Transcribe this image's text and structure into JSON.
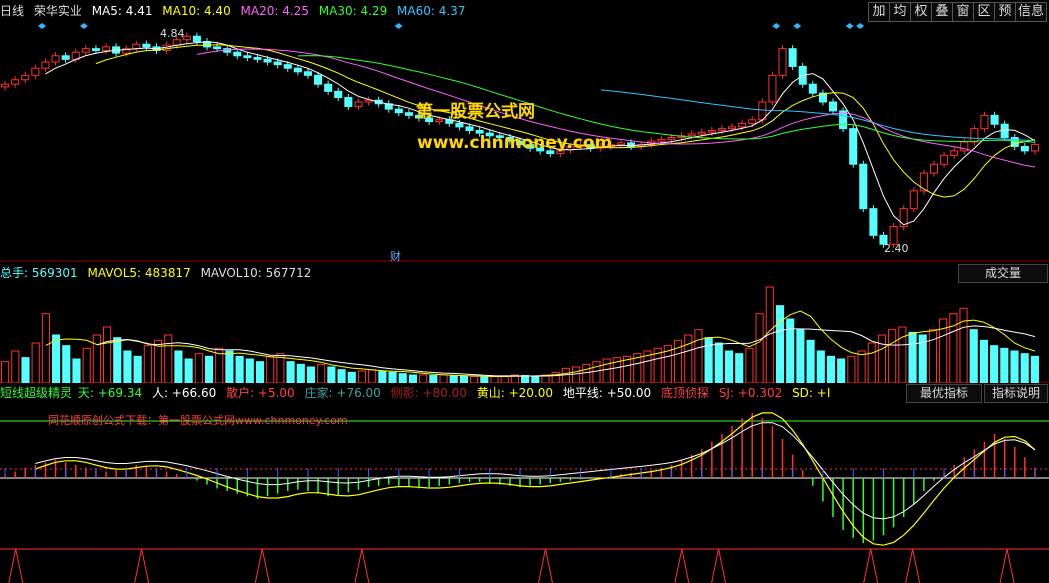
{
  "header": {
    "period": "日线",
    "stock_name": "荣华实业",
    "ma5": "MA5: 4.41",
    "ma10": "MA10: 4.40",
    "ma20": "MA20: 4.25",
    "ma30": "MA30: 4.29",
    "ma60": "MA60: 4.37"
  },
  "toolbar": [
    "加",
    "均",
    "权",
    "叠",
    "窗",
    "区",
    "预",
    "信息"
  ],
  "watermark": {
    "line1": "第一股票公式网",
    "line2": "www.chnmoney.com"
  },
  "price_labels": {
    "high": "4.84",
    "low": "2.40",
    "finance_marker": "财"
  },
  "volume_header": {
    "total": "总手: 569301",
    "mavol5": "MAVOL5: 483817",
    "mavol10": "MAVOL10: 567712",
    "selector": "成交量"
  },
  "indicator_header": {
    "name": "短线超级精灵",
    "tian": "天: +69.34",
    "ren": "人: +66.60",
    "sanhu": "散户: +5.00",
    "zhuangjia": "庄家: +76.00",
    "cejing": "侧影: +80.00",
    "huangshan": "黄山: +20.00",
    "dipingxian": "地平线: +50.00",
    "dingdi": "底顶侦探",
    "sj": "SJ: +0.302",
    "sd": "SD: +I",
    "btn_best": "最优指标",
    "btn_help": "指标说明"
  },
  "indicator_note": "同花顺原创公式下载：第一股票公式网www.chnmoney.com",
  "chart_data": {
    "type": "bar",
    "panes": [
      {
        "name": "price",
        "kind": "candlestick",
        "ylim": [
          2.3,
          5.0
        ],
        "close_series": [
          4.3,
          4.35,
          4.4,
          4.48,
          4.55,
          4.62,
          4.58,
          4.66,
          4.7,
          4.68,
          4.72,
          4.65,
          4.7,
          4.75,
          4.72,
          4.68,
          4.74,
          4.8,
          4.84,
          4.78,
          4.72,
          4.7,
          4.66,
          4.62,
          4.6,
          4.58,
          4.55,
          4.52,
          4.48,
          4.44,
          4.4,
          4.3,
          4.22,
          4.15,
          4.05,
          4.1,
          4.12,
          4.08,
          4.02,
          3.98,
          3.95,
          3.92,
          3.88,
          3.9,
          3.86,
          3.82,
          3.78,
          3.75,
          3.72,
          3.7,
          3.66,
          3.62,
          3.58,
          3.55,
          3.52,
          3.56,
          3.6,
          3.62,
          3.58,
          3.6,
          3.62,
          3.64,
          3.6,
          3.62,
          3.66,
          3.68,
          3.7,
          3.72,
          3.74,
          3.76,
          3.78,
          3.8,
          3.82,
          3.86,
          3.9,
          4.1,
          4.4,
          4.7,
          4.5,
          4.3,
          4.2,
          4.1,
          4.0,
          3.8,
          3.4,
          2.9,
          2.6,
          2.5,
          2.7,
          2.9,
          3.1,
          3.3,
          3.4,
          3.5,
          3.55,
          3.65,
          3.8,
          3.95,
          3.85,
          3.7,
          3.6,
          3.55,
          3.62
        ]
      },
      {
        "name": "volume",
        "kind": "bar",
        "values": [
          80,
          120,
          95,
          150,
          260,
          180,
          140,
          90,
          130,
          180,
          210,
          170,
          120,
          100,
          140,
          160,
          180,
          120,
          90,
          110,
          100,
          130,
          120,
          100,
          90,
          80,
          100,
          110,
          80,
          70,
          60,
          70,
          60,
          50,
          40,
          45,
          50,
          45,
          40,
          35,
          30,
          30,
          28,
          30,
          26,
          25,
          25,
          22,
          24,
          26,
          30,
          28,
          26,
          30,
          40,
          55,
          60,
          70,
          80,
          90,
          95,
          100,
          110,
          120,
          130,
          140,
          160,
          180,
          200,
          170,
          150,
          120,
          110,
          130,
          260,
          360,
          290,
          240,
          200,
          160,
          120,
          100,
          90,
          100,
          120,
          150,
          180,
          200,
          210,
          190,
          180,
          200,
          240,
          260,
          280,
          200,
          160,
          140,
          130,
          120,
          110,
          100
        ]
      },
      {
        "name": "indicator",
        "kind": "histogram",
        "values": [
          2,
          5,
          8,
          10,
          12,
          14,
          12,
          10,
          8,
          6,
          5,
          6,
          8,
          10,
          9,
          7,
          5,
          3,
          1,
          -2,
          -5,
          -8,
          -10,
          -12,
          -14,
          -16,
          -14,
          -12,
          -10,
          -9,
          -10,
          -12,
          -14,
          -13,
          -11,
          -9,
          -7,
          -6,
          -5,
          -6,
          -7,
          -8,
          -7,
          -6,
          -5,
          -4,
          -3,
          -3,
          -4,
          -5,
          -6,
          -7,
          -6,
          -5,
          -4,
          -3,
          -2,
          -1,
          0,
          1,
          2,
          3,
          4,
          5,
          6,
          8,
          10,
          14,
          18,
          22,
          28,
          34,
          40,
          46,
          50,
          46,
          40,
          30,
          18,
          6,
          -6,
          -18,
          -30,
          -40,
          -46,
          -50,
          -48,
          -44,
          -38,
          -30,
          -20,
          -10,
          -2,
          4,
          10,
          16,
          22,
          28,
          34,
          30,
          24,
          16,
          8
        ]
      }
    ],
    "moving_averages": {
      "MA5": 4.41,
      "MA10": 4.4,
      "MA20": 4.25,
      "MA30": 4.29,
      "MA60": 4.37
    },
    "colors": {
      "up": "#ff3030",
      "down": "#54ffff",
      "ma5": "#ffffff",
      "ma10": "#ffff00",
      "ma20": "#ff60ff",
      "ma30": "#30ff30",
      "ma60": "#33c4ff"
    }
  }
}
